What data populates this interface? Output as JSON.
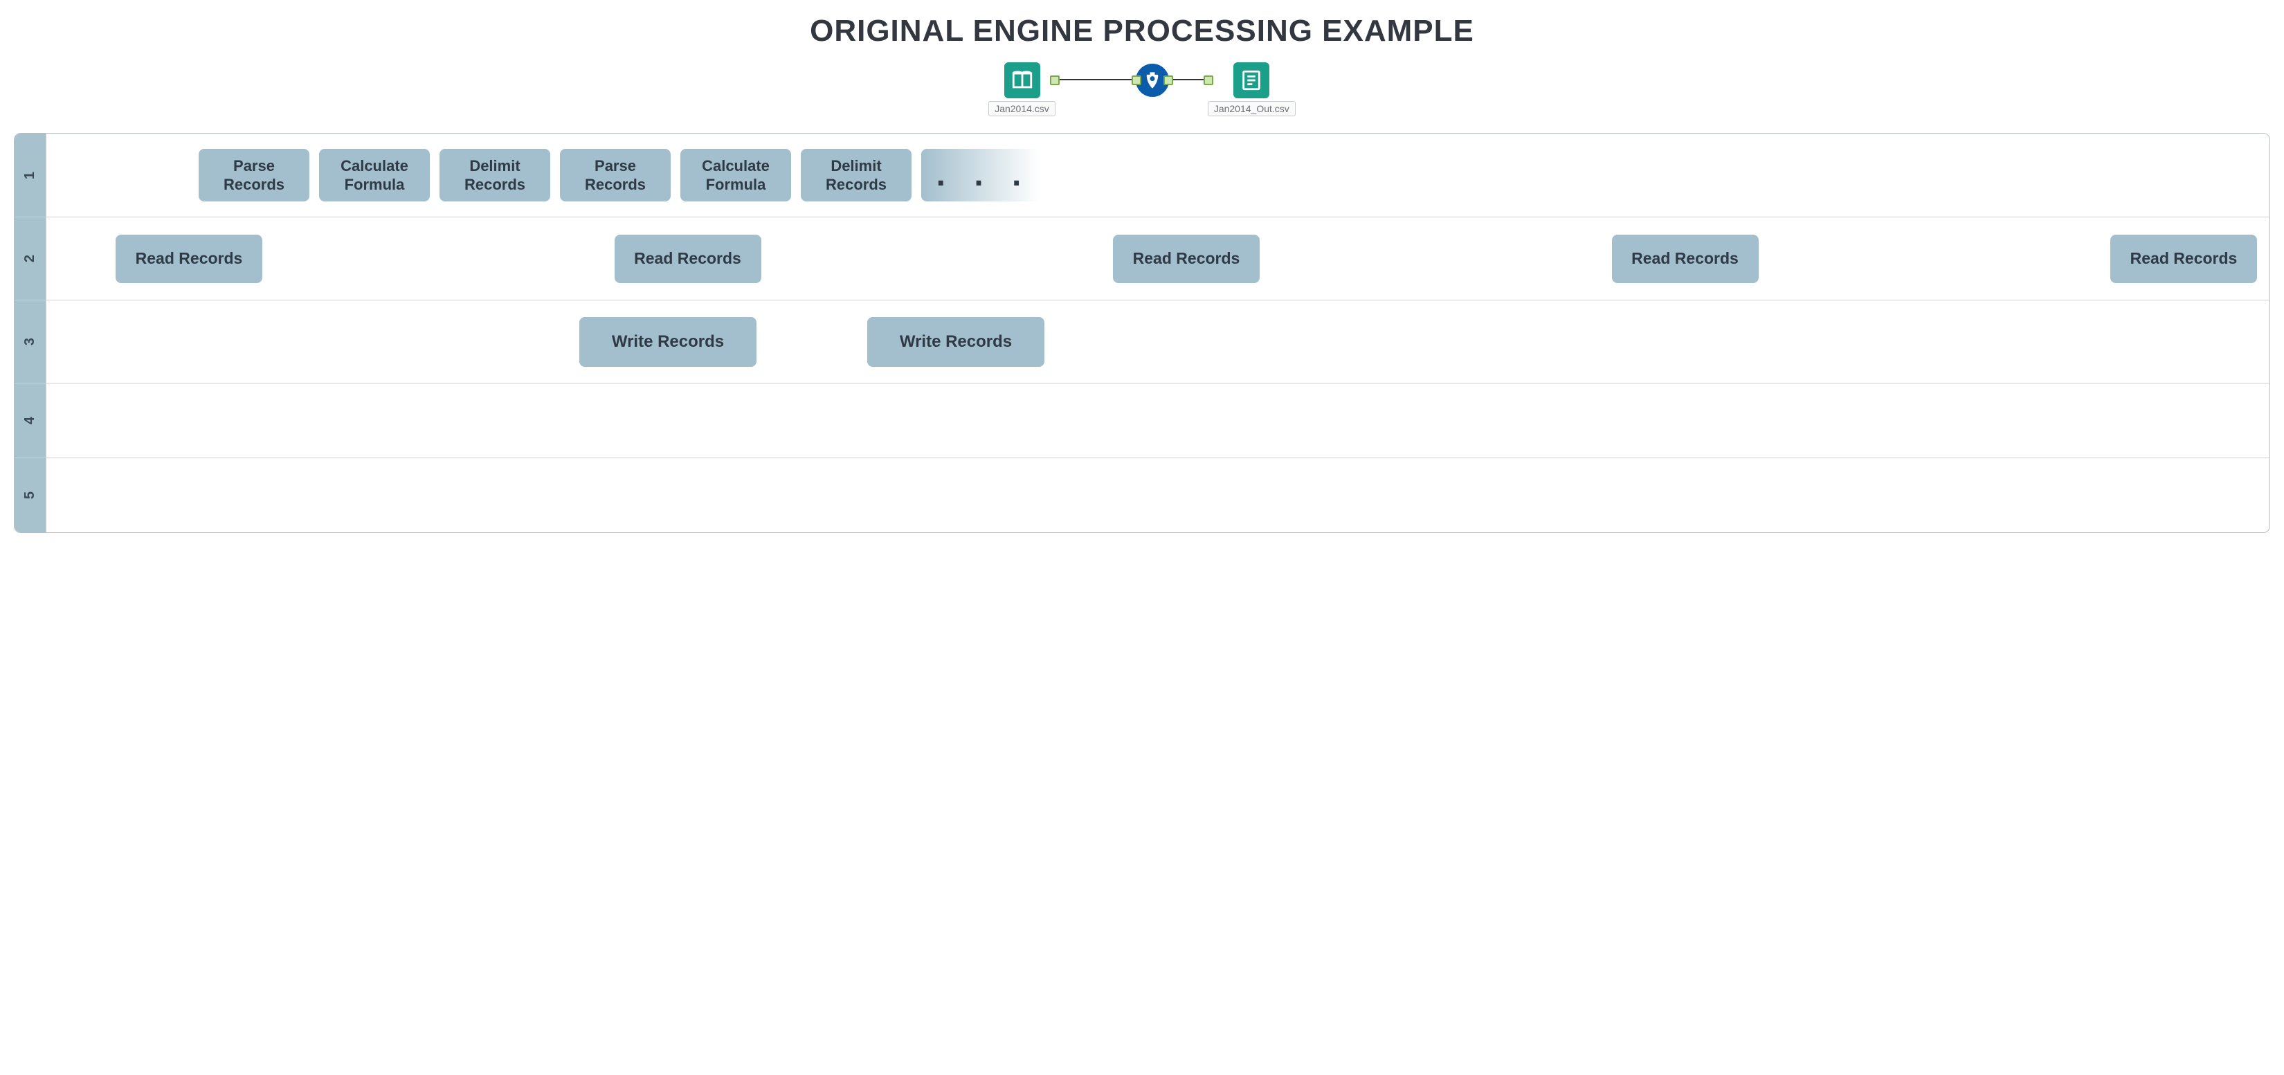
{
  "title": "ORIGINAL ENGINE PROCESSING EXAMPLE",
  "workflow": {
    "input_label": "Jan2014.csv",
    "output_label": "Jan2014_Out.csv"
  },
  "lanes": {
    "num1": "1",
    "num2": "2",
    "num3": "3",
    "num4": "4",
    "num5": "5"
  },
  "row1": {
    "b1": "Parse Records",
    "b2": "Calculate Formula",
    "b3": "Delimit Records",
    "b4": "Parse Records",
    "b5": "Calculate Formula",
    "b6": "Delimit Records",
    "b7": ". . ."
  },
  "row2": {
    "b1": "Read Records",
    "b2": "Read Records",
    "b3": "Read Records",
    "b4": "Read Records",
    "b5": "Read Records"
  },
  "row3": {
    "b1": "Write Records",
    "b2": "Write Records"
  }
}
